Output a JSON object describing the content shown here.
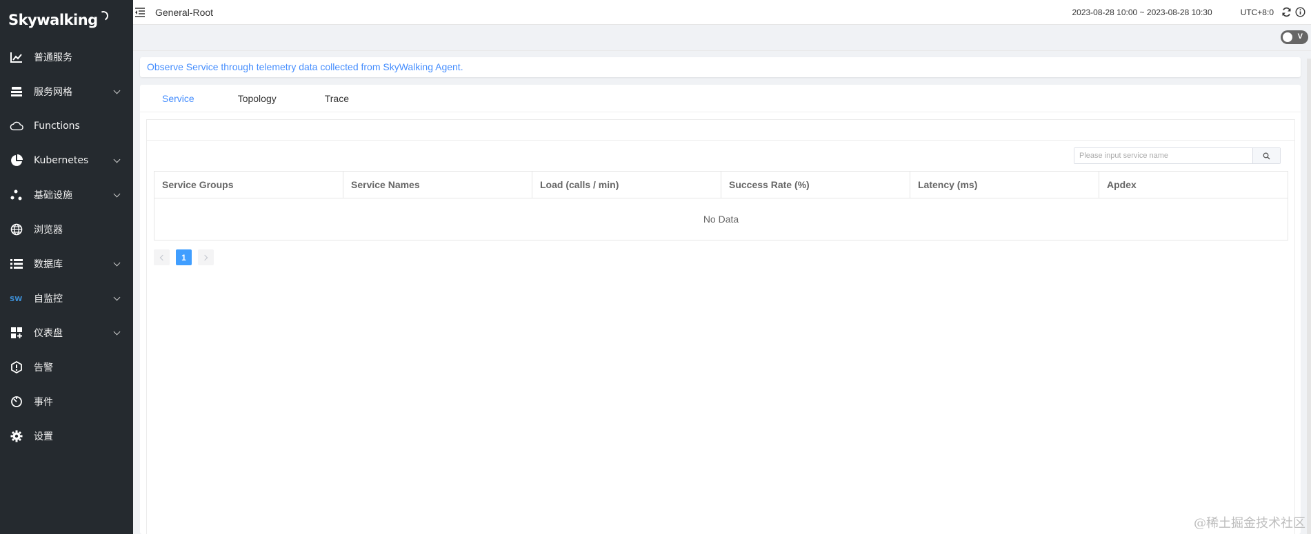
{
  "sidebar": {
    "logo": "Skywalking",
    "items": [
      {
        "label": "普通服务",
        "icon": "chart-icon",
        "expandable": false
      },
      {
        "label": "服务网格",
        "icon": "mesh-icon",
        "expandable": true
      },
      {
        "label": "Functions",
        "icon": "cloud-icon",
        "expandable": false
      },
      {
        "label": "Kubernetes",
        "icon": "pie-icon",
        "expandable": true
      },
      {
        "label": "基础设施",
        "icon": "nodes-icon",
        "expandable": true
      },
      {
        "label": "浏览器",
        "icon": "globe-icon",
        "expandable": false
      },
      {
        "label": "数据库",
        "icon": "list-icon",
        "expandable": true
      },
      {
        "label": "自监控",
        "icon": "sw-icon",
        "expandable": true
      },
      {
        "label": "仪表盘",
        "icon": "dashboard-icon",
        "expandable": true
      },
      {
        "label": "告警",
        "icon": "alarm-icon",
        "expandable": false
      },
      {
        "label": "事件",
        "icon": "event-icon",
        "expandable": false
      },
      {
        "label": "设置",
        "icon": "gear-icon",
        "expandable": false
      }
    ]
  },
  "header": {
    "title": "General-Root",
    "time_range": "2023-08-28 10:00 ~ 2023-08-28 10:30",
    "timezone": "UTC+8:0"
  },
  "toolbar": {
    "toggle_label": "V"
  },
  "intro": "Observe Service through telemetry data collected from SkyWalking Agent.",
  "tabs": [
    {
      "label": "Service",
      "active": true
    },
    {
      "label": "Topology",
      "active": false
    },
    {
      "label": "Trace",
      "active": false
    }
  ],
  "search": {
    "placeholder": "Please input service name",
    "value": ""
  },
  "table": {
    "columns": [
      "Service Groups",
      "Service Names",
      "Load (calls / min)",
      "Success Rate (%)",
      "Latency (ms)",
      "Apdex"
    ],
    "rows": [],
    "empty_text": "No Data"
  },
  "pagination": {
    "current": "1"
  },
  "watermark": "@稀土掘金技术社区",
  "colors": {
    "sidebar_bg": "#252a2f",
    "accent": "#448dfe",
    "page_active": "#409eff"
  }
}
